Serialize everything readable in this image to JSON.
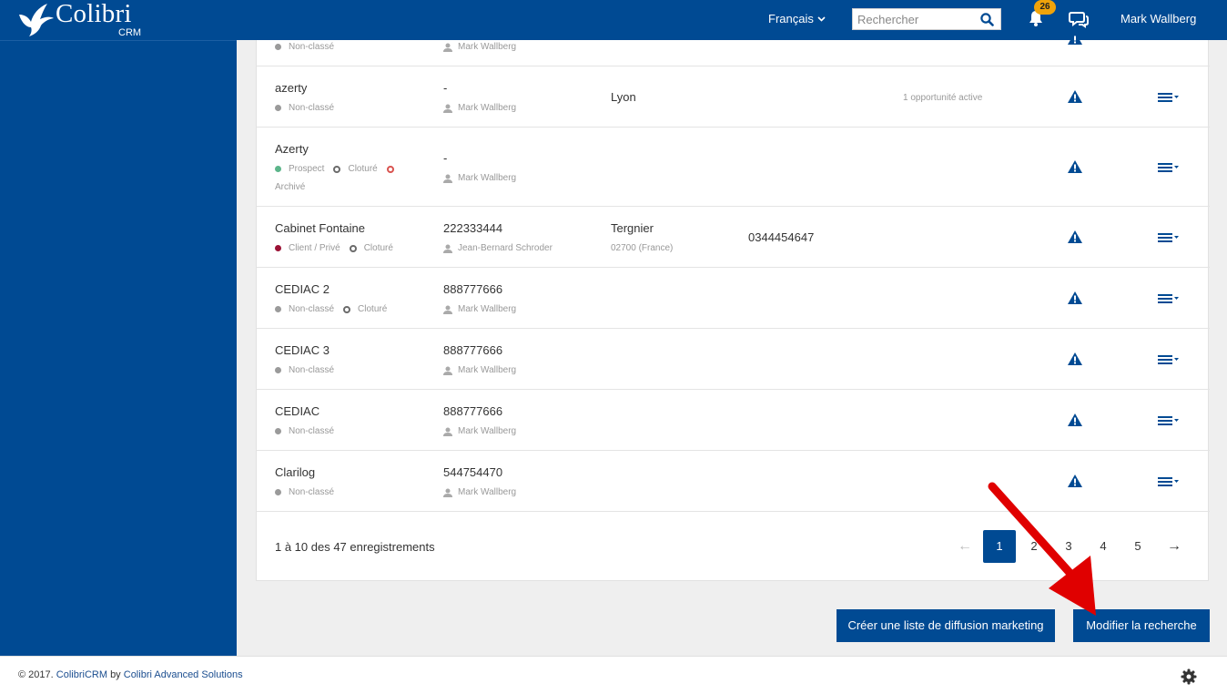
{
  "app": {
    "logo_text": "Colibri",
    "logo_sub": "CRM",
    "language": "Français",
    "search_placeholder": "Rechercher",
    "notifications_count": "26",
    "user_name": "Mark Wallberg"
  },
  "rows": [
    {
      "name": "",
      "id": "",
      "city": "",
      "postal": "",
      "phone": "",
      "opp": "",
      "status": [
        {
          "label": "Non-classé",
          "type": "grey"
        }
      ],
      "owner": "Mark Wallberg"
    },
    {
      "name": "azerty",
      "id": "-",
      "city": "Lyon",
      "postal": "",
      "phone": "",
      "opp": "1 opportunité active",
      "status": [
        {
          "label": "Non-classé",
          "type": "grey"
        }
      ],
      "owner": "Mark Wallberg"
    },
    {
      "name": "Azerty",
      "id": "-",
      "city": "",
      "postal": "",
      "phone": "",
      "opp": "",
      "status": [
        {
          "label": "Prospect",
          "type": "green"
        },
        {
          "label": "Cloturé",
          "type": "ring"
        },
        {
          "label": "Archivé",
          "type": "ring-red"
        }
      ],
      "owner": "Mark Wallberg"
    },
    {
      "name": "Cabinet Fontaine",
      "id": "222333444",
      "city": "Tergnier",
      "postal": "02700 (France)",
      "phone": "0344454647",
      "opp": "",
      "status": [
        {
          "label": "Client / Privé",
          "type": "red"
        },
        {
          "label": "Cloturé",
          "type": "ring"
        }
      ],
      "owner": "Jean-Bernard Schroder"
    },
    {
      "name": "CEDIAC 2",
      "id": "888777666",
      "city": "",
      "postal": "",
      "phone": "",
      "opp": "",
      "status": [
        {
          "label": "Non-classé",
          "type": "grey"
        },
        {
          "label": "Cloturé",
          "type": "ring"
        }
      ],
      "owner": "Mark Wallberg"
    },
    {
      "name": "CEDIAC 3",
      "id": "888777666",
      "city": "",
      "postal": "",
      "phone": "",
      "opp": "",
      "status": [
        {
          "label": "Non-classé",
          "type": "grey"
        }
      ],
      "owner": "Mark Wallberg"
    },
    {
      "name": "CEDIAC",
      "id": "888777666",
      "city": "",
      "postal": "",
      "phone": "",
      "opp": "",
      "status": [
        {
          "label": "Non-classé",
          "type": "grey"
        }
      ],
      "owner": "Mark Wallberg"
    },
    {
      "name": "Clarilog",
      "id": "544754470",
      "city": "",
      "postal": "",
      "phone": "",
      "opp": "",
      "status": [
        {
          "label": "Non-classé",
          "type": "grey"
        }
      ],
      "owner": "Mark Wallberg"
    }
  ],
  "pagination": {
    "summary": "1 à 10 des 47 enregistrements",
    "prev": "←",
    "pages": [
      "1",
      "2",
      "3",
      "4",
      "5"
    ],
    "current": "1",
    "next": "→"
  },
  "buttons": {
    "marketing": "Créer une liste de diffusion marketing",
    "modify": "Modifier la recherche"
  },
  "footer": {
    "copyright": "© 2017.",
    "brand": "ColibriCRM",
    "by": "by",
    "company": "Colibri Advanced Solutions"
  },
  "colors": {
    "primary": "#004a93",
    "badge": "#f0a30a",
    "annotation": "#e00000"
  },
  "icons": [
    "bird-logo-icon",
    "chevron-down-icon",
    "search-icon",
    "bell-icon",
    "chat-icon",
    "user-icon",
    "warning-icon",
    "menu-icon",
    "gear-icon"
  ]
}
